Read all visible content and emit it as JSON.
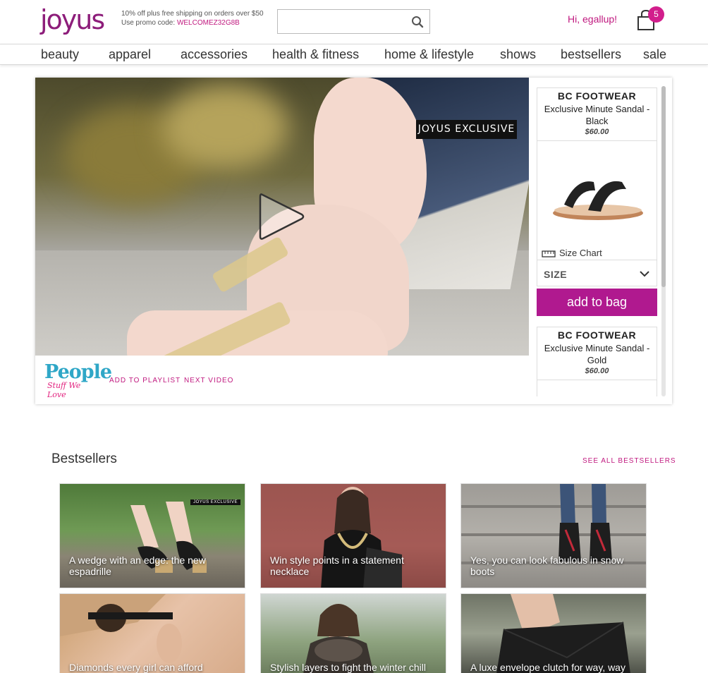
{
  "header": {
    "logo": "joyus",
    "promo_line1": "10% off plus free shipping on orders over $50",
    "promo_line2_prefix": "Use promo code: ",
    "promo_code": "WELCOMEZ32G8B",
    "search": {
      "value": "",
      "placeholder": ""
    },
    "greeting": "Hi, egallup!",
    "cart_count": "5"
  },
  "nav": {
    "items": [
      {
        "label": "beauty"
      },
      {
        "label": "apparel"
      },
      {
        "label": "accessories"
      },
      {
        "label": "health & fitness"
      },
      {
        "label": "home & lifestyle"
      },
      {
        "label": "shows"
      },
      {
        "label": "bestsellers"
      },
      {
        "label": "sale"
      }
    ]
  },
  "video": {
    "exclusive_label": "JOYUS EXCLUSIVE",
    "show_logo_title": "People",
    "show_logo_subtitle": "Stuff We Love",
    "add_to_playlist": "ADD TO PLAYLIST",
    "next_video": "NEXT VIDEO"
  },
  "products": [
    {
      "brand": "BC FOOTWEAR",
      "name": "Exclusive Minute Sandal - Black",
      "price": "$60.00",
      "size_chart": "Size Chart",
      "size_label": "SIZE",
      "add_to_bag": "add to bag"
    },
    {
      "brand": "BC FOOTWEAR",
      "name": "Exclusive Minute Sandal - Gold",
      "price": "$60.00"
    }
  ],
  "bestsellers": {
    "title": "Bestsellers",
    "see_all": "SEE ALL BESTSELLERS",
    "tiles": [
      {
        "caption": "A wedge with an edge: the new espadrille",
        "badge": "JOYUS EXCLUSIVE"
      },
      {
        "caption": "Win style points in a statement necklace"
      },
      {
        "caption": "Yes, you can look fabulous in snow boots"
      },
      {
        "caption": "Diamonds every girl can afford"
      },
      {
        "caption": "Stylish layers to fight the winter chill"
      },
      {
        "caption": "A luxe envelope clutch for way, way"
      }
    ]
  },
  "colors": {
    "brand_magenta": "#c0197f",
    "button_purple": "#b0198f",
    "logo_purple": "#8d1d7a"
  }
}
